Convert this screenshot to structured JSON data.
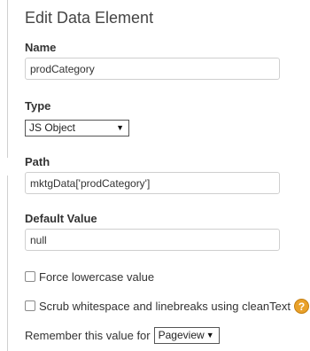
{
  "title": "Edit Data Element",
  "fields": {
    "name": {
      "label": "Name",
      "value": "prodCategory"
    },
    "type": {
      "label": "Type",
      "selected": "JS Object"
    },
    "path": {
      "label": "Path",
      "value": "mktgData['prodCategory']"
    },
    "default_value": {
      "label": "Default Value",
      "value": "null"
    }
  },
  "options": {
    "force_lowercase": {
      "label": "Force lowercase value",
      "checked": false
    },
    "scrub_whitespace": {
      "label": "Scrub whitespace and linebreaks using cleanText",
      "checked": false,
      "help_icon": "?"
    }
  },
  "remember": {
    "label": "Remember this value for",
    "selected": "Pageview"
  },
  "colors": {
    "help_icon_bg": "#e9a12a",
    "border": "#cfcfcf"
  }
}
